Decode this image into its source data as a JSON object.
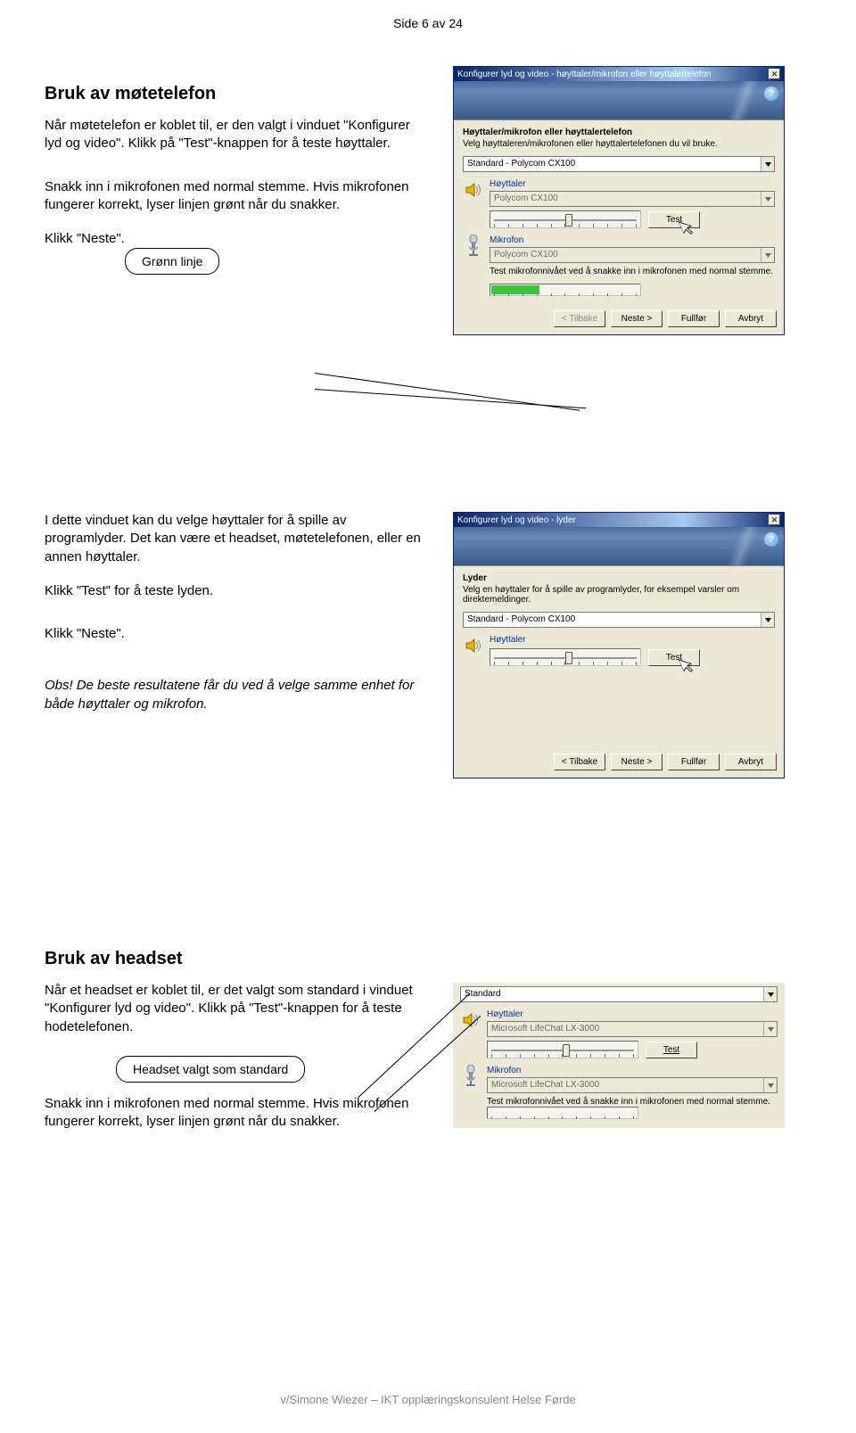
{
  "page_header": "Side 6 av 24",
  "section1": {
    "title": "Bruk av møtetelefon",
    "p1": "Når møtetelefon er koblet til, er den valgt i vinduet \"Konfigurer lyd og video\". Klikk på \"Test\"-knappen for å teste høyttaler.",
    "p2": "Snakk inn i mikrofonen med normal stemme. Hvis mikrofonen fungerer korrekt, lyser linjen grønt når du snakker.",
    "p3": "Klikk \"Neste\".",
    "callout": "Grønn linje"
  },
  "dialog1": {
    "title": "Konfigurer lyd og video - høyttaler/mikrofon eller høyttalertelefon",
    "heading": "Høyttaler/mikrofon eller høyttalertelefon",
    "sub": "Velg høyttaleren/mikrofonen eller høyttalertelefonen du vil bruke.",
    "dropdown": "Standard - Polycom CX100",
    "speaker_label": "Høyttaler",
    "speaker_device": "Polycom CX100",
    "test_btn": "Test",
    "mic_label": "Mikrofon",
    "mic_device": "Polycom CX100",
    "mic_note": "Test mikrofonnivået ved å snakke inn i mikrofonen med normal stemme.",
    "buttons": {
      "back": "< Tilbake",
      "next": "Neste >",
      "finish": "Fullfør",
      "cancel": "Avbryt"
    }
  },
  "section2": {
    "p1": "I dette vinduet kan du velge høyttaler for å spille av programlyder. Det kan være et headset, møtetelefonen, eller en annen høyttaler.",
    "p2": "Klikk \"Test\" for å teste lyden.",
    "p3": "Klikk \"Neste\".",
    "obs": "Obs! De beste resultatene får du ved å velge samme enhet for både høyttaler og mikrofon."
  },
  "dialog2": {
    "title": "Konfigurer lyd og video - lyder",
    "heading": "Lyder",
    "sub": "Velg en høyttaler for å spille av programlyder, for eksempel varsler om direktemeldinger.",
    "dropdown": "Standard - Polycom CX100",
    "speaker_label": "Høyttaler",
    "test_btn": "Test",
    "buttons": {
      "back": "< Tilbake",
      "next": "Neste >",
      "finish": "Fullfør",
      "cancel": "Avbryt"
    }
  },
  "section3": {
    "title": "Bruk av headset",
    "p1": "Når et headset er koblet til, er det valgt som standard i vinduet \"Konfigurer lyd og video\". Klikk på \"Test\"-knappen for å teste hodetelefonen.",
    "callout": "Headset valgt som standard",
    "p2": "Snakk inn i mikrofonen med normal stemme. Hvis mikrofonen fungerer korrekt, lyser linjen grønt når du snakker."
  },
  "panel3": {
    "dropdown": "Standard",
    "speaker_label": "Høyttaler",
    "speaker_device": "Microsoft LifeChat LX-3000",
    "test_btn": "Test",
    "mic_label": "Mikrofon",
    "mic_device": "Microsoft LifeChat LX-3000",
    "mic_note": "Test mikrofonnivået ved å snakke inn i mikrofonen med normal stemme."
  },
  "footer": "v/Simone Wiezer – IKT opplæringskonsulent Helse Førde"
}
